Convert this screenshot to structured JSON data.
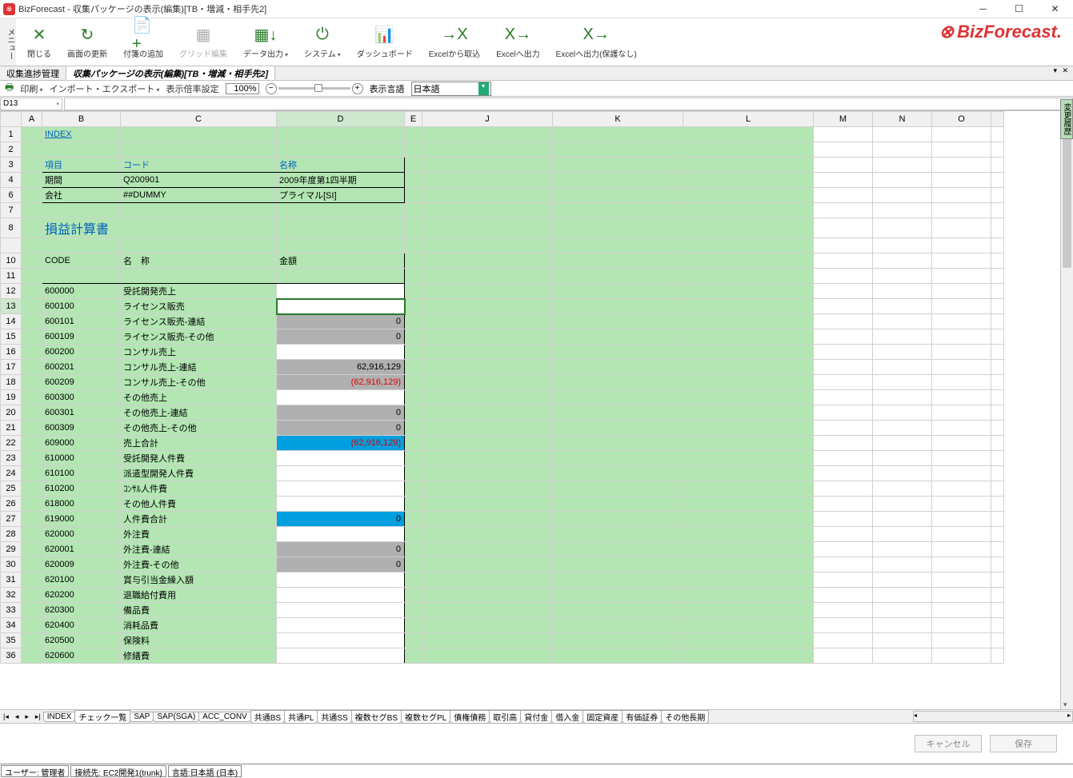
{
  "title": "BizForecast - 収集パッケージの表示(編集)[TB・増減・相手先2]",
  "menu_label": "メニュー",
  "ribbon": [
    {
      "label": "閉じる",
      "icon": "✕",
      "color": "green"
    },
    {
      "label": "画面の更新",
      "icon": "↻",
      "color": "green"
    },
    {
      "label": "付箋の追加",
      "icon": "📄+",
      "color": "green"
    },
    {
      "label": "グリッド編集",
      "icon": "▦",
      "color": "gray",
      "disabled": true
    },
    {
      "label": "データ出力",
      "icon": "▦↓",
      "color": "green",
      "drop": true
    },
    {
      "label": "システム",
      "icon": "⏻",
      "color": "green",
      "drop": true
    },
    {
      "label": "ダッシュボード",
      "icon": "📊",
      "color": "green"
    },
    {
      "label": "Excelから取込",
      "icon": "→X",
      "color": "green"
    },
    {
      "label": "Excelへ出力",
      "icon": "X→",
      "color": "green"
    },
    {
      "label": "Excelへ出力(保護なし)",
      "icon": "X→",
      "color": "green"
    }
  ],
  "logo": "BizForecast.",
  "doc_tabs": [
    {
      "label": "収集進捗管理",
      "active": false
    },
    {
      "label": "収集パッケージの表示(編集)[TB・増減・相手先2]",
      "active": true
    }
  ],
  "settings": {
    "print": "印刷",
    "import_export": "インポート・エクスポート",
    "disp_rate": "表示倍率設定",
    "zoom": "100%",
    "disp_lang_lbl": "表示言語",
    "lang": "日本語"
  },
  "cell_ref": "D13",
  "side_label": "変更履歴",
  "columns": [
    "",
    "A",
    "B",
    "C",
    "D",
    "E",
    "J",
    "K",
    "L",
    "M",
    "N",
    "O",
    ""
  ],
  "index_link": "INDEX",
  "info_header": {
    "b": "項目",
    "c": "コード",
    "d": "名称"
  },
  "info_rows": [
    {
      "b": "期間",
      "c": "Q200901",
      "d": "2009年度第1四半期"
    },
    {
      "b": "会社",
      "c": "##DUMMY",
      "d": "プライマル[SI]"
    }
  ],
  "pl_title": "損益計算書",
  "table_header": {
    "b": "CODE",
    "c": "名　称",
    "d": "金額"
  },
  "rows": [
    {
      "n": 12,
      "code": "600000",
      "name": "受託開発売上",
      "amt": "",
      "style": "white"
    },
    {
      "n": 13,
      "code": "600100",
      "name": "ライセンス販売",
      "amt": "",
      "style": "active"
    },
    {
      "n": 14,
      "code": "600101",
      "name": "ライセンス販売-連結",
      "amt": "0",
      "style": "gray"
    },
    {
      "n": 15,
      "code": "600109",
      "name": "ライセンス販売-その他",
      "amt": "0",
      "style": "gray"
    },
    {
      "n": 16,
      "code": "600200",
      "name": "コンサル売上",
      "amt": "",
      "style": "white"
    },
    {
      "n": 17,
      "code": "600201",
      "name": "コンサル売上-連結",
      "amt": "62,916,129",
      "style": "gray"
    },
    {
      "n": 18,
      "code": "600209",
      "name": "コンサル売上-その他",
      "amt": "(62,916,129)",
      "style": "gray-red"
    },
    {
      "n": 19,
      "code": "600300",
      "name": "その他売上",
      "amt": "",
      "style": "white"
    },
    {
      "n": 20,
      "code": "600301",
      "name": "その他売上-連結",
      "amt": "0",
      "style": "gray"
    },
    {
      "n": 21,
      "code": "600309",
      "name": "その他売上-その他",
      "amt": "0",
      "style": "gray"
    },
    {
      "n": 22,
      "code": "609000",
      "name": "売上合計",
      "amt": "(62,916,129)",
      "style": "blue-red"
    },
    {
      "n": 23,
      "code": "610000",
      "name": "受託開発人件費",
      "amt": "",
      "style": "white"
    },
    {
      "n": 24,
      "code": "610100",
      "name": "派遣型開発人件費",
      "amt": "",
      "style": "white"
    },
    {
      "n": 25,
      "code": "610200",
      "name": "ｺﾝｻﾙ人件費",
      "amt": "",
      "style": "white"
    },
    {
      "n": 26,
      "code": "618000",
      "name": "その他人件費",
      "amt": "",
      "style": "white"
    },
    {
      "n": 27,
      "code": "619000",
      "name": "人件費合計",
      "amt": "0",
      "style": "blue"
    },
    {
      "n": 28,
      "code": "620000",
      "name": "外注費",
      "amt": "",
      "style": "white"
    },
    {
      "n": 29,
      "code": "620001",
      "name": "外注費-連結",
      "amt": "0",
      "style": "gray"
    },
    {
      "n": 30,
      "code": "620009",
      "name": "外注費-その他",
      "amt": "0",
      "style": "gray"
    },
    {
      "n": 31,
      "code": "620100",
      "name": "賞与引当金繰入額",
      "amt": "",
      "style": "white"
    },
    {
      "n": 32,
      "code": "620200",
      "name": "退職給付費用",
      "amt": "",
      "style": "white"
    },
    {
      "n": 33,
      "code": "620300",
      "name": "備品費",
      "amt": "",
      "style": "white"
    },
    {
      "n": 34,
      "code": "620400",
      "name": "消耗品費",
      "amt": "",
      "style": "white"
    },
    {
      "n": 35,
      "code": "620500",
      "name": "保険料",
      "amt": "",
      "style": "white"
    },
    {
      "n": 36,
      "code": "620600",
      "name": "修繕費",
      "amt": "",
      "style": "white"
    }
  ],
  "sheet_tabs": [
    "INDEX",
    "チェック一覧",
    "SAP",
    "SAP(SGA)",
    "ACC_CONV",
    "共通BS",
    "共通PL",
    "共通SS",
    "複数セグBS",
    "複数セグPL",
    "債権債務",
    "取引高",
    "貸付金",
    "借入金",
    "固定資産",
    "有価証券",
    "その他長期"
  ],
  "footer": {
    "cancel": "キャンセル",
    "save": "保存"
  },
  "status": {
    "user": "ユーザー: 管理者",
    "conn": "接続先: EC2開発1(trunk)",
    "lang": "言語:日本語 (日本)"
  }
}
